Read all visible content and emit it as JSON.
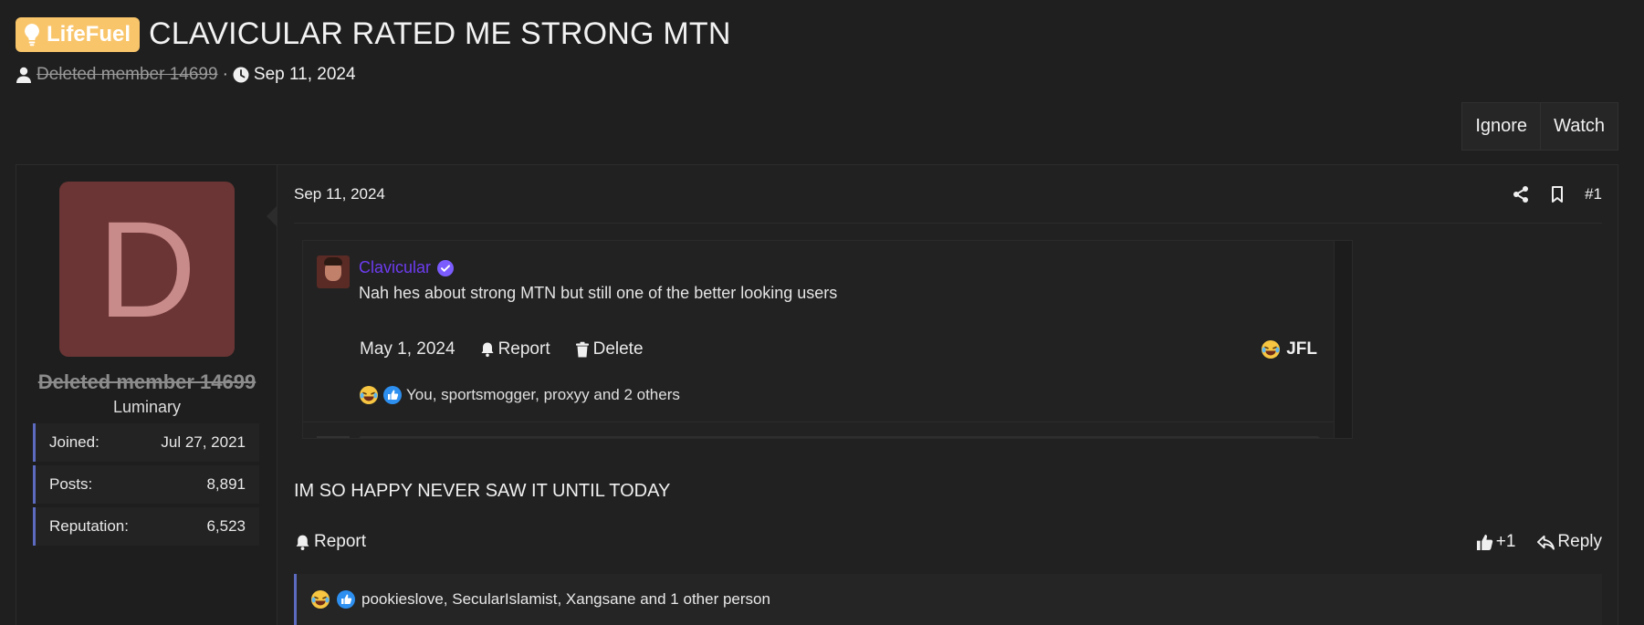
{
  "thread": {
    "prefix": "LifeFuel",
    "title": "CLAVICULAR RATED ME STRONG MTN",
    "author": "Deleted member 14699",
    "separator": "·",
    "date": "Sep 11, 2024"
  },
  "thread_actions": {
    "ignore_label": "Ignore",
    "watch_label": "Watch"
  },
  "post": {
    "user": {
      "avatar_letter": "D",
      "name": "Deleted member 14699",
      "title": "Luminary",
      "stats": [
        {
          "label": "Joined:",
          "value": "Jul 27, 2021"
        },
        {
          "label": "Posts:",
          "value": "8,891"
        },
        {
          "label": "Reputation:",
          "value": "6,523"
        }
      ]
    },
    "date": "Sep 11, 2024",
    "number": "#1",
    "embed": {
      "author": "Clavicular",
      "text": "Nah hes about strong MTN but still one of the better looking users",
      "date": "May 1, 2024",
      "report_label": "Report",
      "delete_label": "Delete",
      "jfl_label": "JFL",
      "reactions_text": "You, sportsmogger, proxyy and 2 others"
    },
    "body": "IM SO HAPPY NEVER SAW IT UNTIL TODAY",
    "report_label": "Report",
    "plus_label": "+1",
    "reply_label": "Reply",
    "reactions_text": "pookieslove, SecularIslamist, Xangsane and 1 other person"
  },
  "colors": {
    "prefix_bg": "#f9c56a",
    "avatar_bg": "#6b3535",
    "embed_name": "#6d3cf0",
    "accent_border": "#5c6bc0"
  },
  "icons": {
    "prefix": "lightbulb-icon",
    "author": "user-icon",
    "date": "clock-icon",
    "share": "share-icon",
    "bookmark": "bookmark-icon",
    "verified": "verified-badge-icon",
    "report": "bell-icon",
    "delete": "trash-icon",
    "jfl": "laughing-emoji-icon",
    "like": "thumbs-up-icon",
    "reply": "reply-icon"
  }
}
